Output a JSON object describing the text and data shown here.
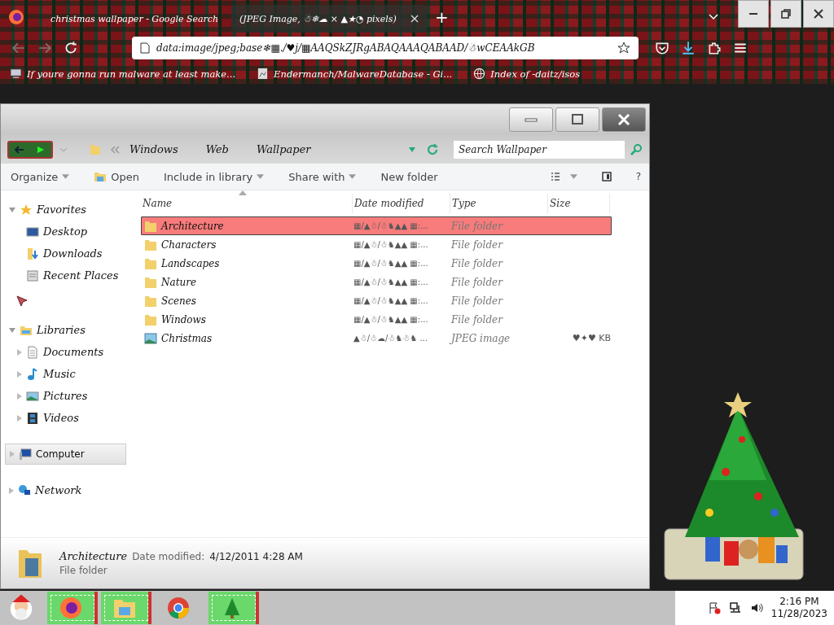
{
  "browser": {
    "tabs": [
      {
        "title": "christmas wallpaper - Google Search",
        "selected": false
      },
      {
        "title": "(JPEG Image, ☃❄☁ × ▲★◔ pixels)",
        "selected": true
      }
    ],
    "new_tab": "+",
    "url": "data:image/jpeg;base❄▦./♥j/▦AAQSkZJRgABAQAAAQABAAD/☃wCEAAkGB",
    "bookmarks": [
      {
        "title": "If youre gonna run malware at least make...",
        "kind": "computer"
      },
      {
        "title": "Endermanch/MalwareDatabase - Gi...",
        "kind": "page"
      },
      {
        "title": "Index of -daitz/isos",
        "kind": "globe"
      }
    ]
  },
  "explorer": {
    "breadcrumb": [
      "Windows",
      "Web",
      "Wallpaper"
    ],
    "search": {
      "placeholder": "Search Wallpaper"
    },
    "commands": [
      {
        "label": "Organize",
        "kind": "menu"
      },
      {
        "label": "Open",
        "kind": "open"
      },
      {
        "label": "Include in library",
        "kind": "menu"
      },
      {
        "label": "Share with",
        "kind": "menu"
      },
      {
        "label": "New folder",
        "kind": "plain"
      }
    ],
    "help": "?",
    "nav": [
      {
        "label": "Favorites",
        "kind": "star",
        "expanded": true,
        "selected": false,
        "children": [
          {
            "label": "Desktop",
            "kind": "desktop",
            "selected": false
          },
          {
            "label": "Downloads",
            "kind": "download",
            "selected": false
          },
          {
            "label": "Recent Places",
            "kind": "recent",
            "selected": false
          }
        ]
      },
      {
        "label": "Libraries",
        "kind": "library",
        "expanded": true,
        "selected": false,
        "children": [
          {
            "label": "Documents",
            "kind": "document",
            "selected": false
          },
          {
            "label": "Music",
            "kind": "music",
            "selected": false
          },
          {
            "label": "Pictures",
            "kind": "picture",
            "selected": false
          },
          {
            "label": "Videos",
            "kind": "video",
            "selected": false
          }
        ]
      },
      {
        "label": "Computer",
        "kind": "computer",
        "expanded": false,
        "selected": true
      },
      {
        "label": "Network",
        "kind": "network",
        "expanded": false,
        "selected": false
      }
    ],
    "columns": [
      "Name",
      "Date modified",
      "Type",
      "Size"
    ],
    "rows": [
      {
        "name": "Architecture",
        "date": "▦/▲☃/☃♞▲▲ ▦:...",
        "type": "File folder",
        "kind": "folder",
        "selected": true
      },
      {
        "name": "Characters",
        "date": "▦/▲☃/☃♞▲▲ ▦:...",
        "type": "File folder",
        "kind": "folder",
        "selected": false
      },
      {
        "name": "Landscapes",
        "date": "▦/▲☃/☃♞▲▲ ▦:...",
        "type": "File folder",
        "kind": "folder",
        "selected": false
      },
      {
        "name": "Nature",
        "date": "▦/▲☃/☃♞▲▲ ▦:...",
        "type": "File folder",
        "kind": "folder",
        "selected": false
      },
      {
        "name": "Scenes",
        "date": "▦/▲☃/☃♞▲▲ ▦:...",
        "type": "File folder",
        "kind": "folder",
        "selected": false
      },
      {
        "name": "Windows",
        "date": "▦/▲☃/☃♞▲▲ ▦:...",
        "type": "File folder",
        "kind": "folder",
        "selected": false
      },
      {
        "name": "Christmas",
        "date": "▲☃/☃☁/☃♞☃♞ ...",
        "type": "JPEG image",
        "size": "♥✦♥ KB",
        "kind": "image",
        "selected": false
      }
    ],
    "details": {
      "name": "Architecture",
      "date_label": "Date modified:",
      "date": "4/12/2011 4:28 AM",
      "type": "File folder"
    }
  },
  "taskbar": {
    "apps": [
      {
        "kind": "firefox",
        "running": true
      },
      {
        "kind": "explorer",
        "running": true
      },
      {
        "kind": "chrome",
        "running": false
      },
      {
        "kind": "tree",
        "running": true
      }
    ],
    "time": "2:16 PM",
    "date": "11/28/2023"
  }
}
